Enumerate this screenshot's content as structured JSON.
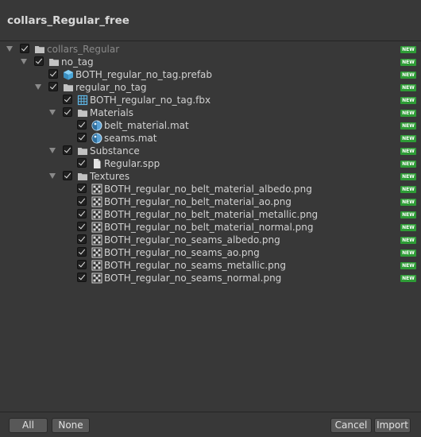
{
  "window": {
    "title": "collars_Regular_free"
  },
  "badge_text": "NEW",
  "tree": [
    {
      "label": "collars_Regular",
      "icon": "folder-icon",
      "depth": 0,
      "foldout": true,
      "dim": true,
      "new": true
    },
    {
      "label": "no_tag",
      "icon": "folder-icon",
      "depth": 1,
      "foldout": true,
      "dim": false,
      "new": true
    },
    {
      "label": "BOTH_regular_no_tag.prefab",
      "icon": "prefab-icon",
      "depth": 2,
      "foldout": false,
      "dim": false,
      "new": true
    },
    {
      "label": "regular_no_tag",
      "icon": "folder-icon",
      "depth": 2,
      "foldout": true,
      "dim": false,
      "new": true
    },
    {
      "label": "BOTH_regular_no_tag.fbx",
      "icon": "mesh-icon",
      "depth": 3,
      "foldout": false,
      "dim": false,
      "new": true
    },
    {
      "label": "Materials",
      "icon": "folder-icon",
      "depth": 3,
      "foldout": true,
      "dim": false,
      "new": true
    },
    {
      "label": "belt_material.mat",
      "icon": "material-icon",
      "depth": 4,
      "foldout": false,
      "dim": false,
      "new": true
    },
    {
      "label": "seams.mat",
      "icon": "material-icon",
      "depth": 4,
      "foldout": false,
      "dim": false,
      "new": true
    },
    {
      "label": "Substance",
      "icon": "folder-icon",
      "depth": 3,
      "foldout": true,
      "dim": false,
      "new": true
    },
    {
      "label": "Regular.spp",
      "icon": "file-icon",
      "depth": 4,
      "foldout": false,
      "dim": false,
      "new": true
    },
    {
      "label": "Textures",
      "icon": "folder-icon",
      "depth": 3,
      "foldout": true,
      "dim": false,
      "new": true
    },
    {
      "label": "BOTH_regular_no_belt_material_albedo.png",
      "icon": "texture-icon",
      "depth": 4,
      "foldout": false,
      "dim": false,
      "new": true
    },
    {
      "label": "BOTH_regular_no_belt_material_ao.png",
      "icon": "texture-icon",
      "depth": 4,
      "foldout": false,
      "dim": false,
      "new": true
    },
    {
      "label": "BOTH_regular_no_belt_material_metallic.png",
      "icon": "texture-icon",
      "depth": 4,
      "foldout": false,
      "dim": false,
      "new": true
    },
    {
      "label": "BOTH_regular_no_belt_material_normal.png",
      "icon": "texture-icon",
      "depth": 4,
      "foldout": false,
      "dim": false,
      "new": true
    },
    {
      "label": "BOTH_regular_no_seams_albedo.png",
      "icon": "texture-icon",
      "depth": 4,
      "foldout": false,
      "dim": false,
      "new": true
    },
    {
      "label": "BOTH_regular_no_seams_ao.png",
      "icon": "texture-icon",
      "depth": 4,
      "foldout": false,
      "dim": false,
      "new": true
    },
    {
      "label": "BOTH_regular_no_seams_metallic.png",
      "icon": "texture-icon",
      "depth": 4,
      "foldout": false,
      "dim": false,
      "new": true
    },
    {
      "label": "BOTH_regular_no_seams_normal.png",
      "icon": "texture-icon",
      "depth": 4,
      "foldout": false,
      "dim": false,
      "new": true
    }
  ],
  "buttons": {
    "all": "All",
    "none": "None",
    "cancel": "Cancel",
    "import": "Import"
  },
  "colors": {
    "background": "#383838",
    "badge": "#2e9c36",
    "folder": "#c2c2c2",
    "prefab": "#5fb8e8"
  }
}
